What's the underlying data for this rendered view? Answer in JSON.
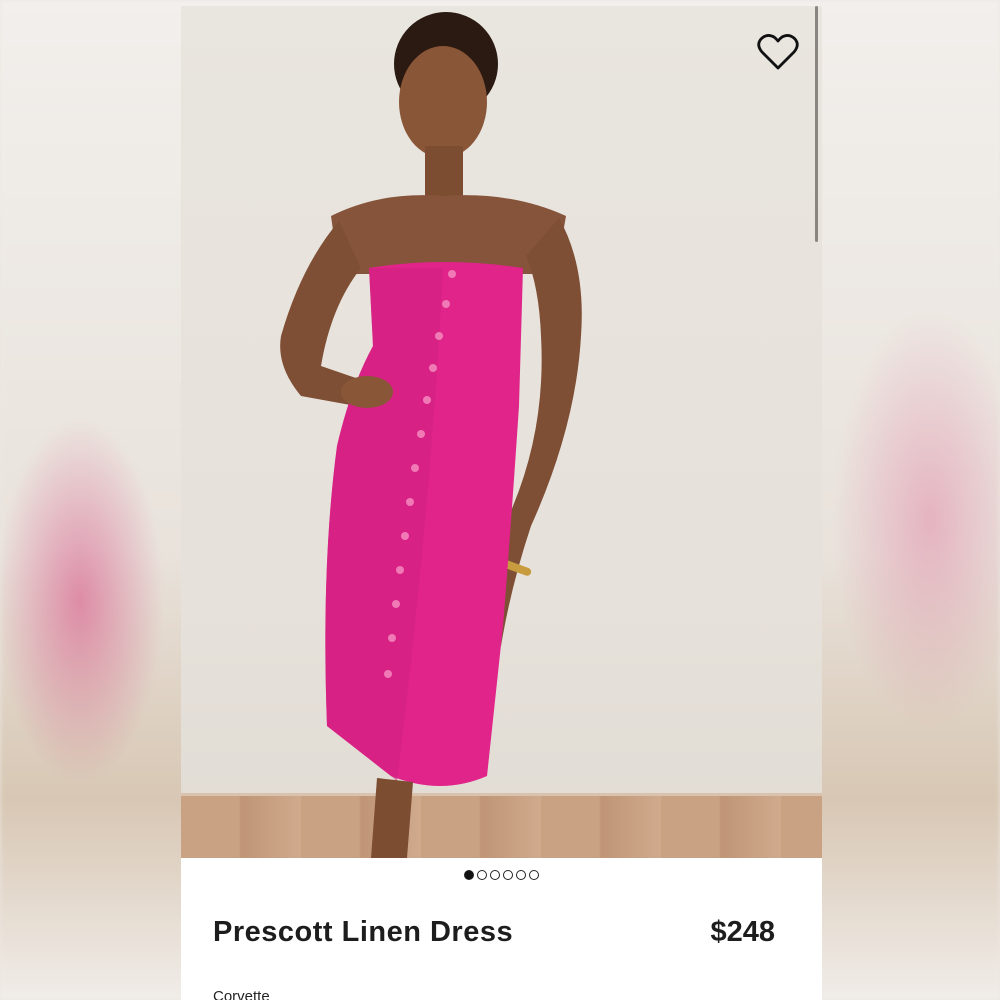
{
  "product": {
    "title": "Prescott Linen Dress",
    "price": "$248",
    "color_name": "Corvette"
  },
  "carousel": {
    "total_images": 6,
    "active_index": 0
  },
  "favorite": {
    "icon": "heart-icon"
  },
  "colors": {
    "dress": "#e0248a",
    "text": "#1d1d1d"
  }
}
